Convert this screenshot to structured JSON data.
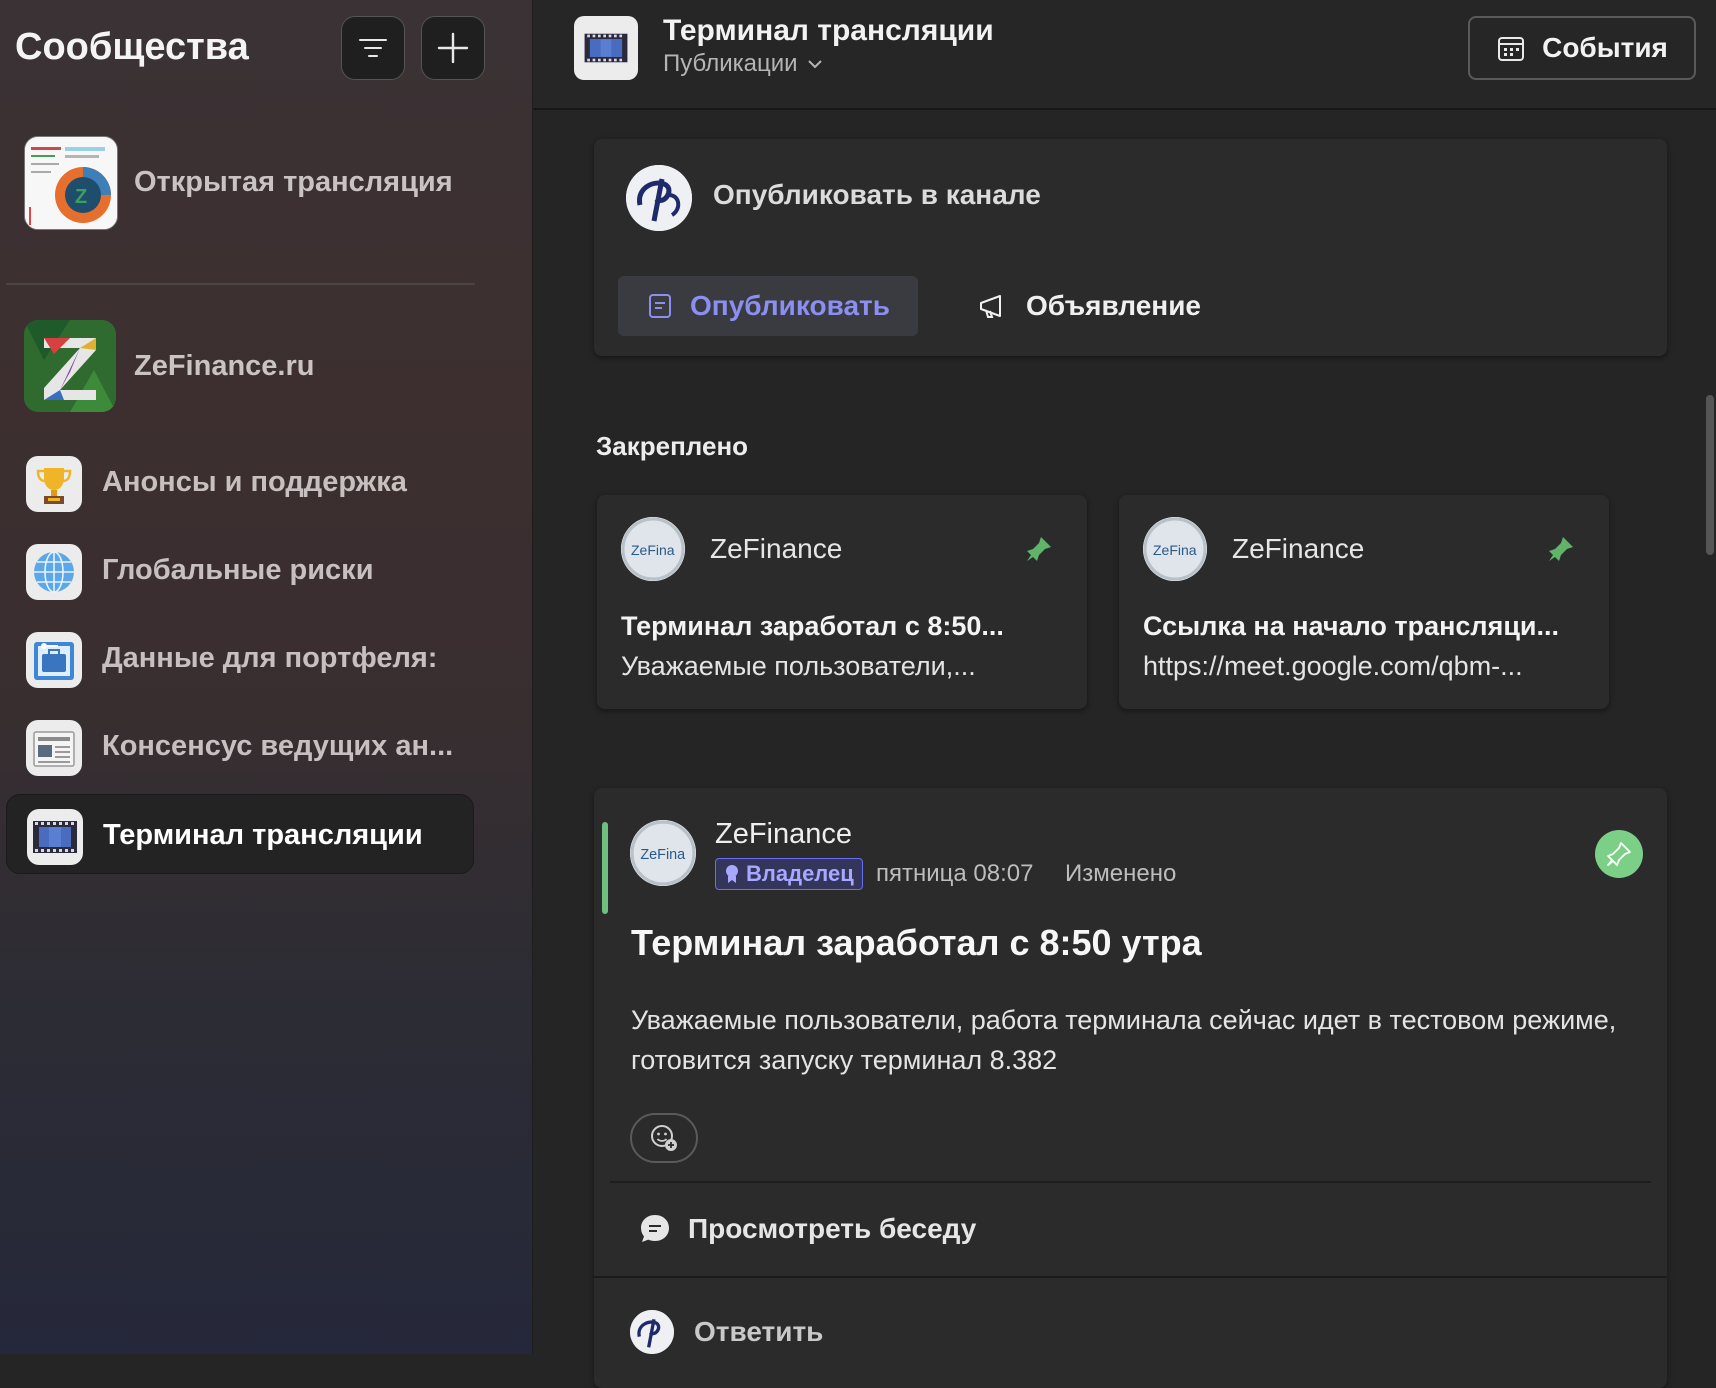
{
  "sidebar": {
    "title": "Сообщества",
    "filter_icon": "filter-lines-icon",
    "add_icon": "plus-icon",
    "featured": {
      "label": "Открытая трансляция"
    },
    "community": {
      "label": "ZeFinance.ru"
    },
    "channels": [
      {
        "label": "Анонсы и поддержка",
        "icon": "trophy-icon"
      },
      {
        "label": "Глобальные риски",
        "icon": "globe-icon"
      },
      {
        "label": "Данные для портфеля:",
        "icon": "briefcase-icon"
      },
      {
        "label": "Консенсус ведущих ан...",
        "icon": "newspaper-icon"
      },
      {
        "label": "Терминал трансляции",
        "icon": "film-strip-icon",
        "selected": true
      }
    ]
  },
  "header": {
    "title": "Терминал трансляции",
    "subtitle": "Публикации",
    "events_label": "События"
  },
  "composer": {
    "prompt": "Опубликовать в канале",
    "publish_label": "Опубликовать",
    "announce_label": "Объявление"
  },
  "pinned": {
    "section_title": "Закреплено",
    "items": [
      {
        "author": "ZeFinance",
        "title": "Терминал заработал с 8:50...",
        "preview": "Уважаемые пользователи,..."
      },
      {
        "author": "ZeFinance",
        "title": "Ссылка на начало трансляци...",
        "preview": "https://meet.google.com/qbm-..."
      }
    ]
  },
  "post": {
    "author": "ZeFinance",
    "badge": "Владелец",
    "time": "пятница 08:07",
    "edited": "Изменено",
    "title": "Терминал заработал с 8:50 утра",
    "body": "Уважаемые пользователи, работа терминала сейчас идет в тестовом режиме, готовится запуску терминал 8.382",
    "view_thread": "Просмотреть беседу",
    "reply": "Ответить"
  },
  "colors": {
    "accent": "#8b8ff0",
    "pin_green": "#6fbf80",
    "owner_badge": "#6a6ef0"
  }
}
